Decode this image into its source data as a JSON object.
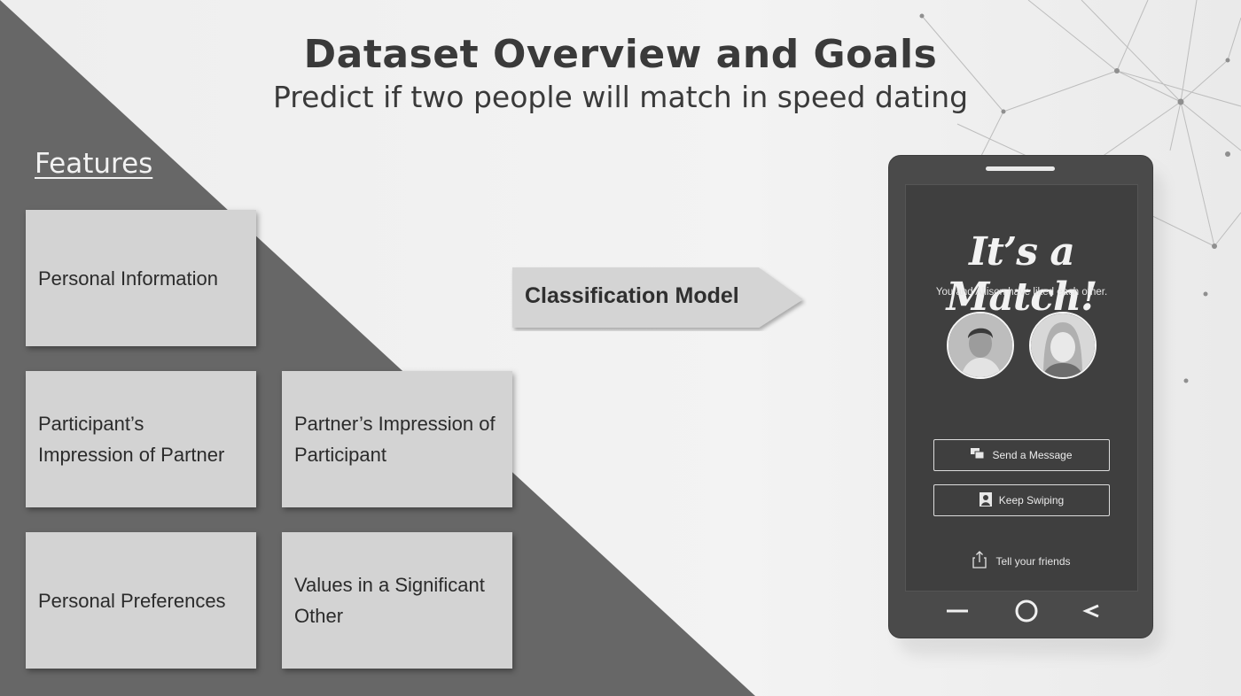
{
  "slide": {
    "title": "Dataset Overview and Goals",
    "subtitle": "Predict if two people will match in speed dating",
    "features_heading": "Features",
    "features": [
      {
        "label": "Personal Information"
      },
      {
        "label": "Participant’s Impression of Partner"
      },
      {
        "label": "Partner’s Impression of Participant"
      },
      {
        "label": "Personal Preferences"
      },
      {
        "label": "Values in a Significant Other"
      }
    ],
    "arrow_label": "Classification Model"
  },
  "phone": {
    "match_title": "It’s a Match!",
    "match_subtitle": "You and Allison have liked each other.",
    "buttons": {
      "send_message": "Send a Message",
      "keep_swiping": "Keep Swiping"
    },
    "tell_friends": "Tell your friends",
    "nav_icons": [
      "recent-apps-icon",
      "home-icon",
      "back-icon"
    ]
  },
  "colors": {
    "background": "#eeeeee",
    "dark_triangle": "#676767",
    "card": "#d3d3d3",
    "title_text": "#3a3a3a",
    "phone_body": "#4a4a4a",
    "phone_screen": "#3f3f3f"
  }
}
